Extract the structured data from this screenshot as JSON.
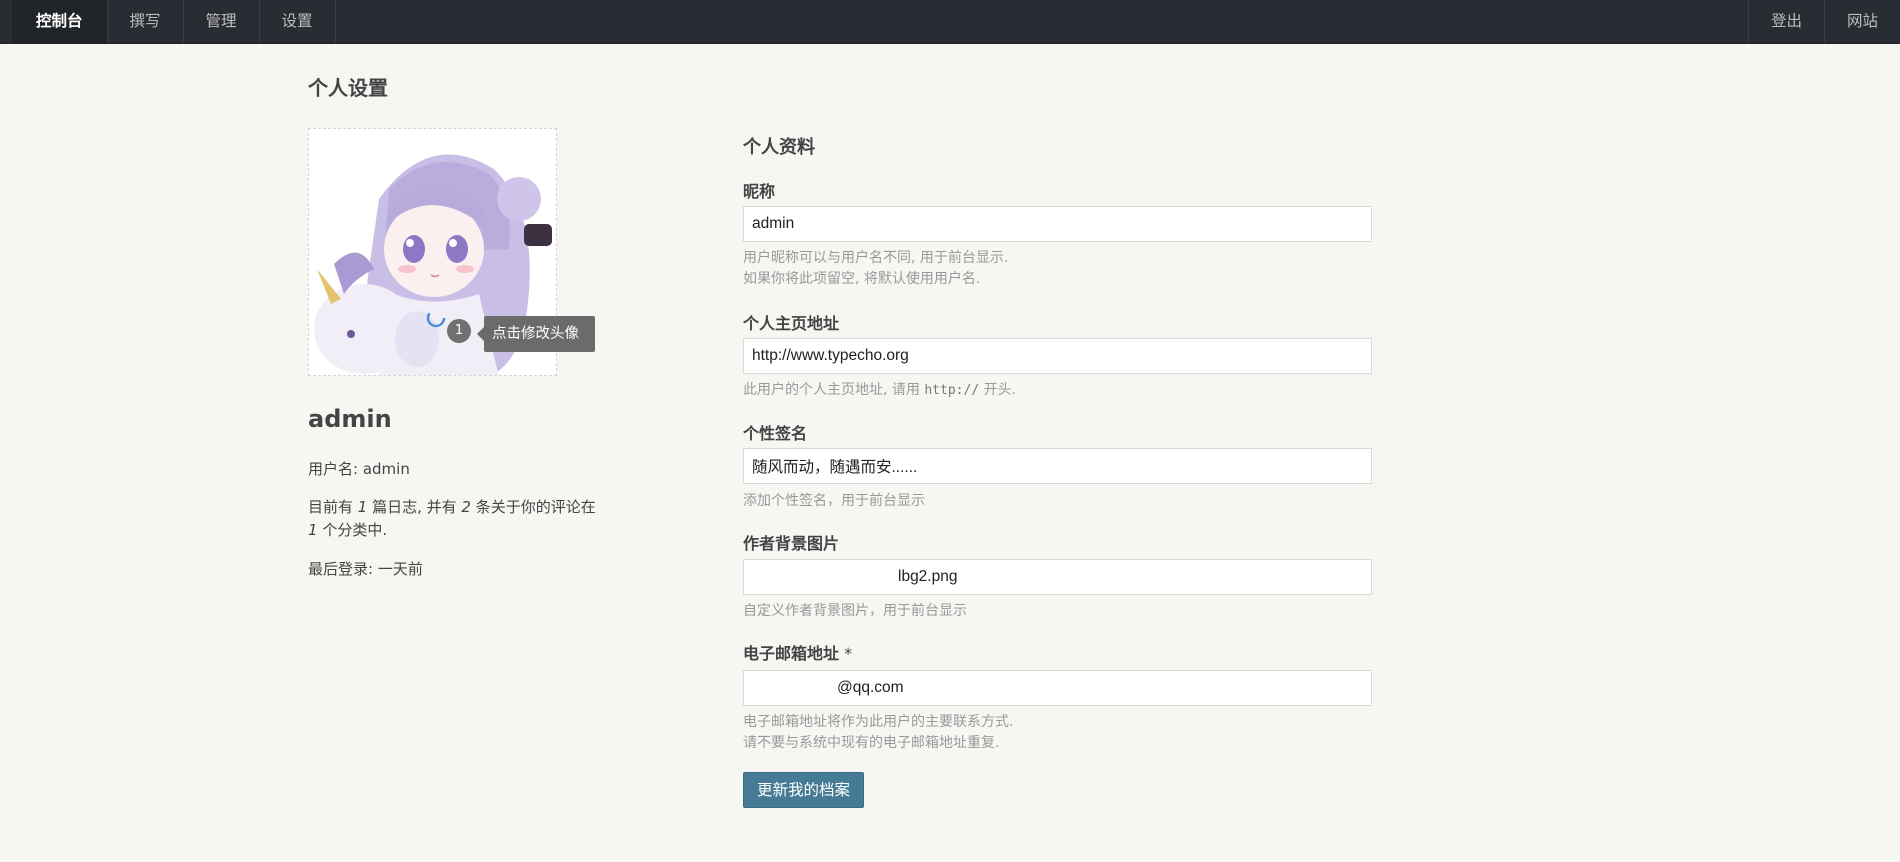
{
  "nav": {
    "left": [
      "控制台",
      "撰写",
      "管理",
      "设置"
    ],
    "right": [
      "登出",
      "网站"
    ]
  },
  "page_title": "个人设置",
  "profile": {
    "avatar_tip": "点击修改头像",
    "avatar_count": "1",
    "name": "admin",
    "username_label": "用户名: ",
    "username": "admin",
    "stats_prefix": "目前有 ",
    "posts": "1",
    "stats_mid1": " 篇日志, 并有 ",
    "comments": "2",
    "stats_mid2": " 条关于你的评论在",
    "categories": "1",
    "stats_suffix": " 个分类中.",
    "last_login": "最后登录: 一天前"
  },
  "form": {
    "section_title": "个人资料",
    "nickname": {
      "label": "昵称",
      "value": "admin",
      "desc1": "用户昵称可以与用户名不同, 用于前台显示.",
      "desc2": "如果你将此项留空, 将默认使用用户名."
    },
    "homepage": {
      "label": "个人主页地址",
      "value": "http://www.typecho.org",
      "desc_before": "此用户的个人主页地址, 请用 ",
      "desc_code": "http://",
      "desc_after": " 开头."
    },
    "signature": {
      "label": "个性签名",
      "value": "随风而动，随遇而安......",
      "desc": "添加个性签名，用于前台显示"
    },
    "background": {
      "label": "作者背景图片",
      "value": "lbg2.png",
      "desc": "自定义作者背景图片，用于前台显示"
    },
    "email": {
      "label": "电子邮箱地址",
      "required_mark": " *",
      "value": "@qq.com",
      "desc1": "电子邮箱地址将作为此用户的主要联系方式.",
      "desc2": "请不要与系统中现有的电子邮箱地址重复."
    },
    "submit_label": "更新我的档案"
  }
}
